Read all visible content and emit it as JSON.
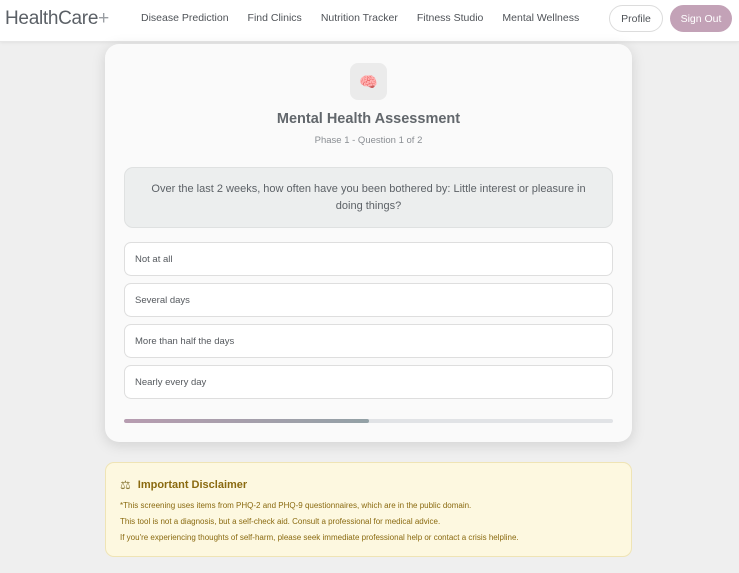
{
  "nav": {
    "logo_text": "HealthCare",
    "logo_plus": "+",
    "links": [
      "Disease Prediction",
      "Find Clinics",
      "Nutrition Tracker",
      "Fitness Studio",
      "Mental Wellness"
    ],
    "profile_label": "Profile",
    "signout_label": "Sign Out"
  },
  "assessment": {
    "icon": "brain-icon",
    "icon_glyph": "🧠",
    "title": "Mental Health Assessment",
    "subtitle": "Phase 1 - Question 1 of 2",
    "question": "Over the last 2 weeks, how often have you been bothered by: Little interest or pleasure in doing things?",
    "options": [
      "Not at all",
      "Several days",
      "More than half the days",
      "Nearly every day"
    ],
    "progress_fraction": 0.5
  },
  "disclaimer": {
    "icon": "scale-icon",
    "icon_glyph": "⚖",
    "title": "Important Disclaimer",
    "lines": [
      "*This screening uses items from PHQ-2 and PHQ-9 questionnaires, which are in the public domain.",
      "This tool is not a diagnosis, but a self-check aid. Consult a professional for medical advice.",
      "If you're experiencing thoughts of self-harm, please seek immediate professional help or contact a crisis helpline."
    ]
  },
  "colors": {
    "accent": "#c3a2b7",
    "disclaimer_bg": "#fdf8e0",
    "disclaimer_text": "#8a6a10"
  }
}
